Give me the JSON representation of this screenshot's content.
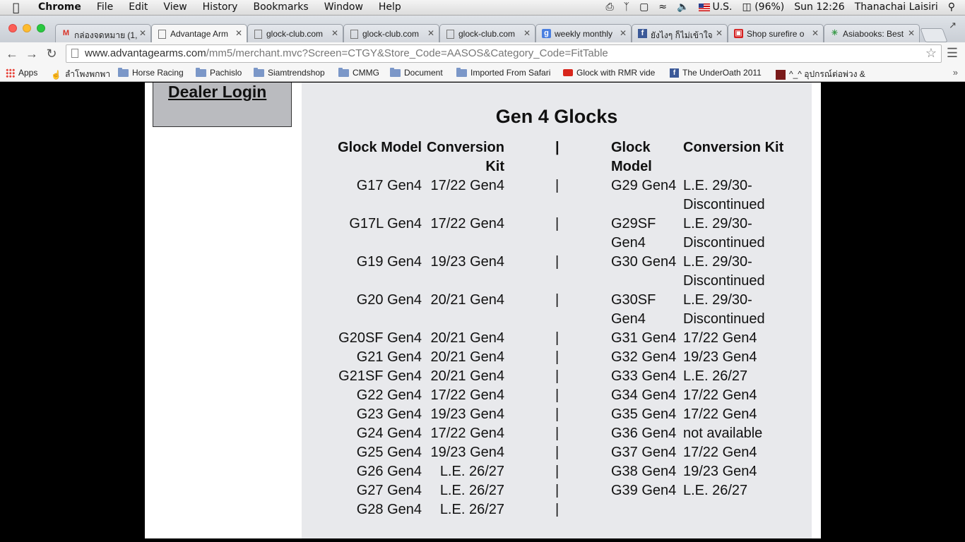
{
  "menubar": {
    "app_name": "Chrome",
    "menus": [
      "File",
      "Edit",
      "View",
      "History",
      "Bookmarks",
      "Window",
      "Help"
    ],
    "input_source": "U.S.",
    "battery": "(96%)",
    "clock": "Sun 12:26",
    "user": "Thanachai Laisiri"
  },
  "tabs": [
    {
      "title": "กล่องจดหมาย (1,",
      "icon": "gmail-icon",
      "active": false
    },
    {
      "title": "Advantage Arm",
      "icon": "page-icon",
      "active": true
    },
    {
      "title": "glock-club.com",
      "icon": "page-icon",
      "active": false
    },
    {
      "title": "glock-club.com",
      "icon": "page-icon",
      "active": false
    },
    {
      "title": "glock-club.com",
      "icon": "page-icon",
      "active": false
    },
    {
      "title": "weekly monthly",
      "icon": "google-icon",
      "active": false
    },
    {
      "title": "ยังไงๆ ก็ไม่เข้าใจ",
      "icon": "facebook-icon",
      "active": false
    },
    {
      "title": "Shop surefire o",
      "icon": "cart-icon",
      "active": false
    },
    {
      "title": "Asiabooks: Best",
      "icon": "asterisk-icon",
      "active": false
    }
  ],
  "address_bar": {
    "host": "www.advantagearms.com",
    "path": "/mm5/merchant.mvc?Screen=CTGY&Store_Code=AASOS&Category_Code=FitTable"
  },
  "bookmarks": [
    {
      "label": "Apps",
      "icon": "apps-grid-icon"
    },
    {
      "label": "ลำโพงพกพา",
      "icon": "hand-icon"
    },
    {
      "label": "Horse Racing",
      "icon": "folder-icon"
    },
    {
      "label": "Pachislo",
      "icon": "folder-icon"
    },
    {
      "label": "Siamtrendshop",
      "icon": "folder-icon"
    },
    {
      "label": "CMMG",
      "icon": "folder-icon"
    },
    {
      "label": "Document",
      "icon": "folder-icon"
    },
    {
      "label": "Imported From Safari",
      "icon": "folder-icon"
    },
    {
      "label": "Glock with RMR vide",
      "icon": "youtube-icon"
    },
    {
      "label": "The UnderOath 2011",
      "icon": "facebook-icon"
    },
    {
      "label": "^_^ อุปกรณ์ต่อพ่วง &",
      "icon": "bookmark-icon"
    }
  ],
  "sidebar": {
    "dealer_login": "Dealer Login"
  },
  "table": {
    "title": "Gen 4 Glocks",
    "headers": {
      "left_model": "Glock Model",
      "left_kit_1": "Conversion",
      "left_kit_2": "Kit",
      "separator": "|",
      "right_model_1": "Glock",
      "right_model_2": "Model",
      "right_kit": "Conversion Kit"
    },
    "left_rows": [
      {
        "model": "G17 Gen4",
        "kit": "17/22 Gen4"
      },
      {
        "model": "G17L Gen4",
        "kit": "17/22 Gen4"
      },
      {
        "model": "G19 Gen4",
        "kit": "19/23 Gen4"
      },
      {
        "model": "G20 Gen4",
        "kit": "20/21 Gen4"
      },
      {
        "model": "G20SF Gen4",
        "kit": "20/21 Gen4"
      },
      {
        "model": "G21 Gen4",
        "kit": "20/21 Gen4"
      },
      {
        "model": "G21SF Gen4",
        "kit": "20/21 Gen4"
      },
      {
        "model": "G22 Gen4",
        "kit": "17/22 Gen4"
      },
      {
        "model": "G23 Gen4",
        "kit": "19/23 Gen4"
      },
      {
        "model": "G24 Gen4",
        "kit": "17/22 Gen4"
      },
      {
        "model": "G25 Gen4",
        "kit": "19/23 Gen4"
      },
      {
        "model": "G26 Gen4",
        "kit": "L.E. 26/27"
      },
      {
        "model": "G27 Gen4",
        "kit": "L.E. 26/27"
      },
      {
        "model": "G28 Gen4",
        "kit": "L.E. 26/27"
      }
    ],
    "right_rows": [
      {
        "model_1": "G29 Gen4",
        "model_2": "",
        "kit_1": "L.E. 29/30-",
        "kit_2": "Discontinued"
      },
      {
        "model_1": "G29SF",
        "model_2": "Gen4",
        "kit_1": "L.E. 29/30-",
        "kit_2": "Discontinued"
      },
      {
        "model_1": "G30 Gen4",
        "model_2": "",
        "kit_1": "L.E. 29/30-",
        "kit_2": "Discontinued"
      },
      {
        "model_1": "G30SF",
        "model_2": "Gen4",
        "kit_1": "L.E. 29/30-",
        "kit_2": "Discontinued"
      },
      {
        "model_1": "G31 Gen4",
        "model_2": "",
        "kit_1": "17/22 Gen4",
        "kit_2": ""
      },
      {
        "model_1": "G32 Gen4",
        "model_2": "",
        "kit_1": "19/23 Gen4",
        "kit_2": ""
      },
      {
        "model_1": "G33 Gen4",
        "model_2": "",
        "kit_1": "L.E. 26/27",
        "kit_2": ""
      },
      {
        "model_1": "G34 Gen4",
        "model_2": "",
        "kit_1": "17/22 Gen4",
        "kit_2": ""
      },
      {
        "model_1": "G35 Gen4",
        "model_2": "",
        "kit_1": "17/22 Gen4",
        "kit_2": ""
      },
      {
        "model_1": "G36 Gen4",
        "model_2": "",
        "kit_1": "not available",
        "kit_2": ""
      },
      {
        "model_1": "G37 Gen4",
        "model_2": "",
        "kit_1": "17/22 Gen4",
        "kit_2": ""
      },
      {
        "model_1": "G38 Gen4",
        "model_2": "",
        "kit_1": "19/23 Gen4",
        "kit_2": ""
      },
      {
        "model_1": "G39 Gen4",
        "model_2": "",
        "kit_1": "L.E. 26/27",
        "kit_2": ""
      }
    ]
  }
}
